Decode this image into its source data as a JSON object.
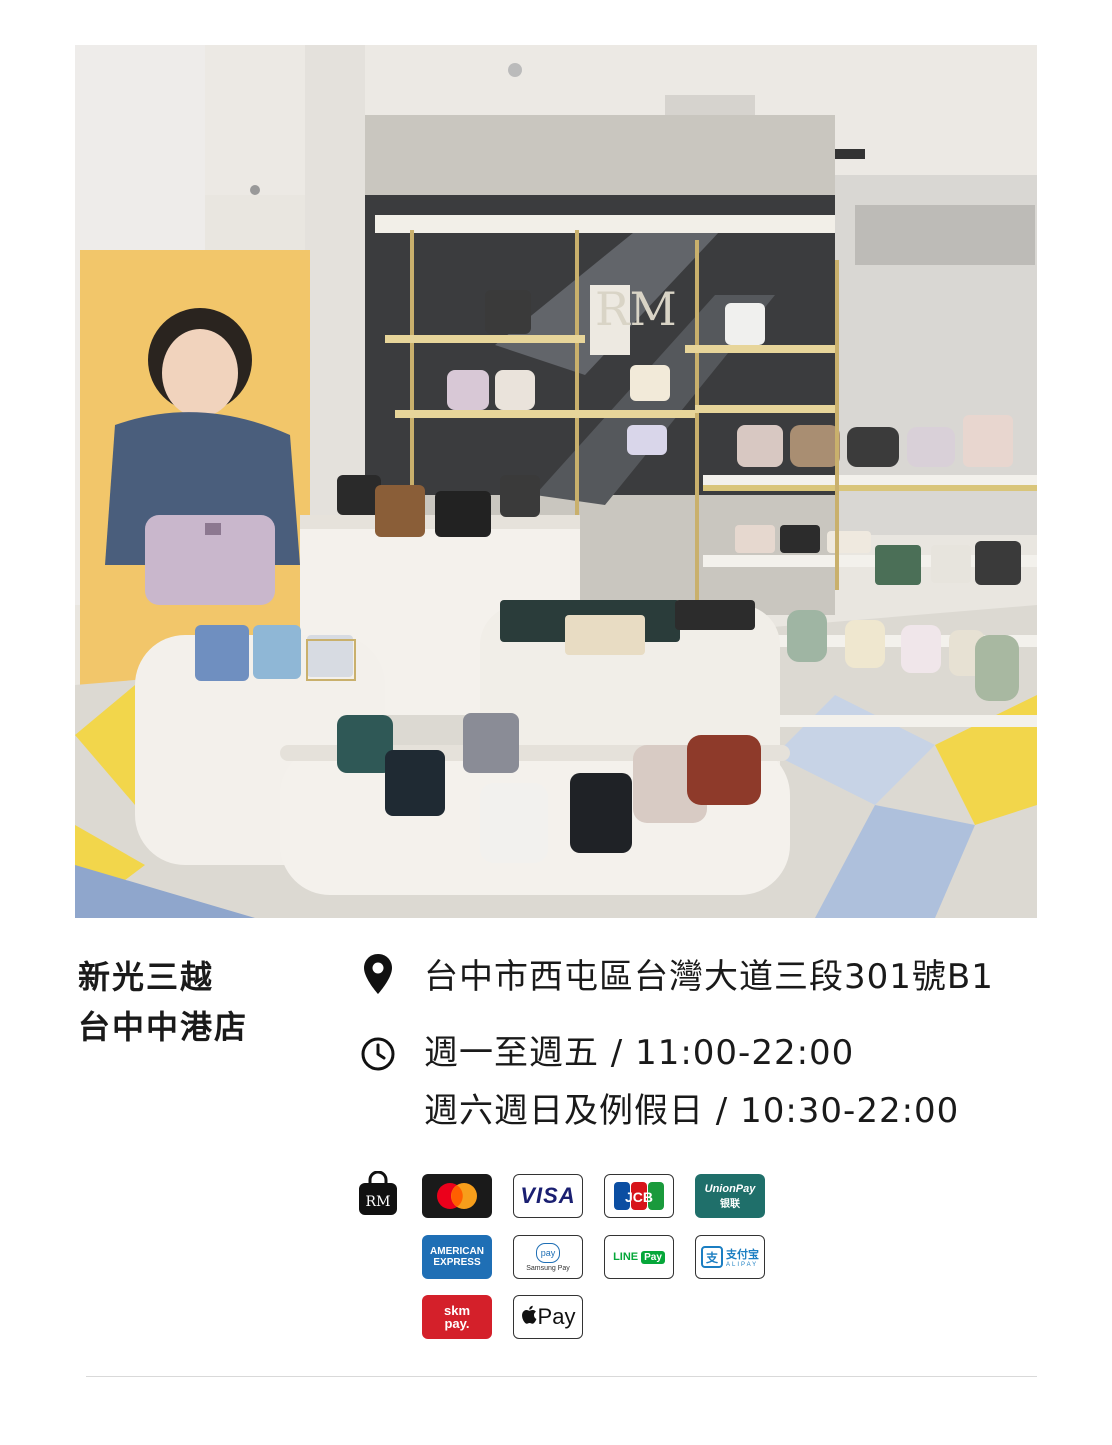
{
  "store": {
    "name_line1": "新光三越",
    "name_line2": "台中中港店"
  },
  "info": {
    "address_icon": "map-pin-icon",
    "address": "台中市西屯區台灣大道三段301號B1",
    "hours_icon": "clock-icon",
    "hours_weekday": "週一至週五 / 11:00-22:00",
    "hours_weekend": "週六週日及例假日 / 10:30-22:00"
  },
  "payments": {
    "bag_icon": "shopping-bag-icon",
    "bag_text": "RM",
    "visa": "VISA",
    "jcb": "JCB",
    "unionpay_top": "UnionPay",
    "unionpay_bottom": "银联",
    "amex_line1": "AMERICAN",
    "amex_line2": "EXPRESS",
    "samsung_badge": "pay",
    "samsung_text": "Samsung Pay",
    "linepay_line": "LINE",
    "linepay_pay": "Pay",
    "alipay_mark": "支",
    "alipay_cn": "支付宝",
    "alipay_en": "ALIPAY",
    "skm_line1": "skm",
    "skm_line2": "pay.",
    "applepay_text": "Pay"
  },
  "colors": {
    "text": "#1a1a1a",
    "mastercard_red": "#eb001b",
    "mastercard_orange": "#f79e1b",
    "visa_blue": "#1a1f71",
    "unionpay_teal": "#1f6f6a",
    "amex_blue": "#1f6fb5",
    "line_green": "#06a73a",
    "skm_red": "#d4202a"
  }
}
